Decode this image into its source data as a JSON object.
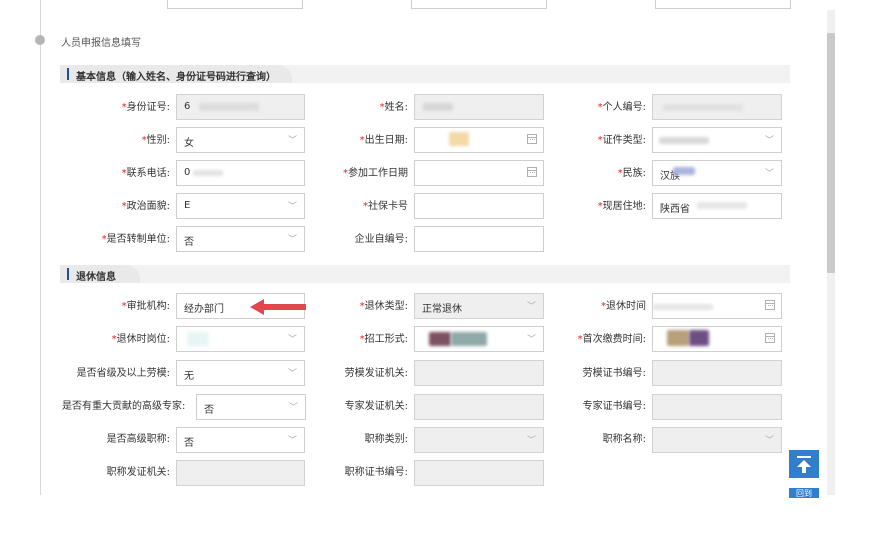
{
  "page": {
    "title": "人员申报信息填写"
  },
  "sections": {
    "basic": {
      "title": "基本信息（输入姓名、身份证号码进行查询）"
    },
    "retire": {
      "title": "退休信息"
    }
  },
  "basic_fields": {
    "id_number": {
      "label": "身份证号:",
      "value": "6"
    },
    "name": {
      "label": "姓名:",
      "value": ""
    },
    "personal_no": {
      "label": "个人编号:",
      "value": ""
    },
    "gender": {
      "label": "性别:",
      "value": "女"
    },
    "birth_date": {
      "label": "出生日期:",
      "value": ""
    },
    "cert_type": {
      "label": "证件类型:",
      "value": ""
    },
    "phone": {
      "label": "联系电话:",
      "value": "0"
    },
    "work_start": {
      "label": "参加工作日期",
      "value": ""
    },
    "ethnicity": {
      "label": "民族:",
      "value": "汉族"
    },
    "political": {
      "label": "政治面貌:",
      "value": "E"
    },
    "social_card": {
      "label": "社保卡号",
      "value": ""
    },
    "address": {
      "label": "现居住地:",
      "value": "陕西省"
    },
    "transferred_unit": {
      "label": "是否转制单位:",
      "value": "否"
    },
    "company_no": {
      "label": "企业自编号:",
      "value": ""
    }
  },
  "retire_fields": {
    "approval_org": {
      "label": "审批机构:",
      "value": "经办部门"
    },
    "retire_type": {
      "label": "退休类型:",
      "value": "正常退休"
    },
    "retire_time": {
      "label": "退休时间",
      "value": ""
    },
    "retire_post": {
      "label": "退休时岗位:",
      "value": ""
    },
    "recruit_form": {
      "label": "招工形式:",
      "value": ""
    },
    "first_pay_time": {
      "label": "首次缴费时间:",
      "value": ""
    },
    "model_worker": {
      "label": "是否省级及以上劳模:",
      "value": "无"
    },
    "model_issuer": {
      "label": "劳模发证机关:",
      "value": ""
    },
    "model_cert_no": {
      "label": "劳模证书编号:",
      "value": ""
    },
    "expert": {
      "label": "是否有重大贡献的高级专家:",
      "value": "否"
    },
    "expert_issuer": {
      "label": "专家发证机关:",
      "value": ""
    },
    "expert_cert_no": {
      "label": "专家证书编号:",
      "value": ""
    },
    "senior_title": {
      "label": "是否高级职称:",
      "value": "否"
    },
    "title_category": {
      "label": "职称类别:",
      "value": ""
    },
    "title_name": {
      "label": "职称名称:",
      "value": ""
    },
    "title_issuer": {
      "label": "职称发证机关:",
      "value": ""
    },
    "title_cert_no": {
      "label": "职称证书编号:",
      "value": ""
    }
  },
  "buttons": {
    "back_label": "回到"
  },
  "icons": {
    "dropdown": "chevron-down-icon",
    "calendar": "calendar-icon",
    "back_to_top": "arrow-up-icon",
    "annotation": "red-arrow-icon"
  },
  "colors": {
    "accent": "#1a4f9c",
    "required": "#e02020",
    "annotation_arrow": "#e0474f",
    "back_to_top": "#2f7fce",
    "disabled_field": "#efefef"
  }
}
